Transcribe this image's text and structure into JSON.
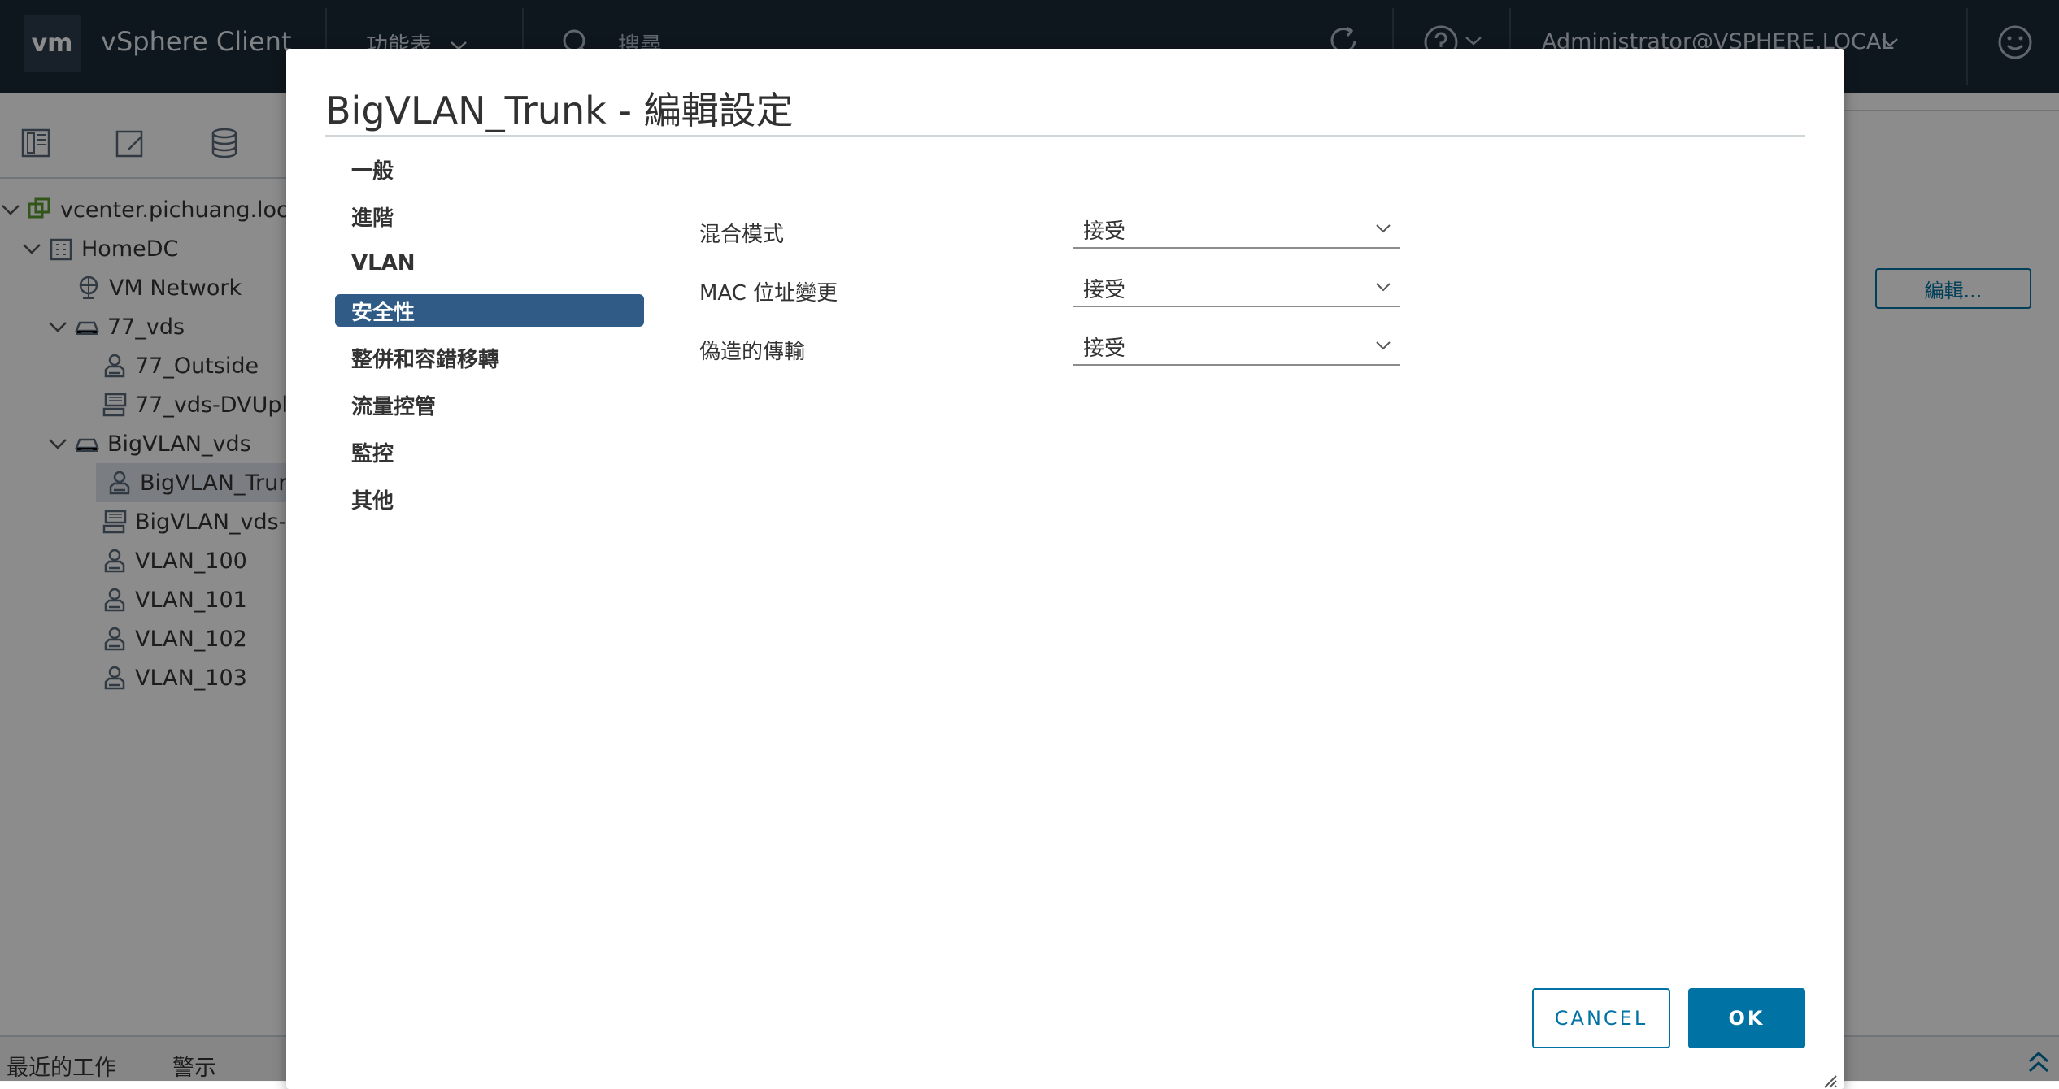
{
  "header": {
    "logo": "vm",
    "app_title": "vSphere Client",
    "menu_label": "功能表",
    "search_placeholder": "搜尋",
    "user": "Administrator@VSPHERE.LOCAL"
  },
  "tree": {
    "items": [
      {
        "label": "vcenter.pichuang.local",
        "icon": "vcenter-icon"
      },
      {
        "label": "HomeDC",
        "icon": "datacenter-icon"
      },
      {
        "label": "VM Network",
        "icon": "network-icon"
      },
      {
        "label": "77_vds",
        "icon": "vds-icon"
      },
      {
        "label": "77_Outside",
        "icon": "portgroup-icon"
      },
      {
        "label": "77_vds-DVUpl",
        "icon": "uplink-portgroup-icon"
      },
      {
        "label": "BigVLAN_vds",
        "icon": "vds-icon"
      },
      {
        "label": "BigVLAN_Trur",
        "icon": "portgroup-icon",
        "selected": true
      },
      {
        "label": "BigVLAN_vds-",
        "icon": "uplink-portgroup-icon"
      },
      {
        "label": "VLAN_100",
        "icon": "portgroup-icon"
      },
      {
        "label": "VLAN_101",
        "icon": "portgroup-icon"
      },
      {
        "label": "VLAN_102",
        "icon": "portgroup-icon"
      },
      {
        "label": "VLAN_103",
        "icon": "portgroup-icon"
      }
    ]
  },
  "background": {
    "edit_button": "編輯..."
  },
  "bottom": {
    "recent_tasks": "最近的工作",
    "alarms": "警示"
  },
  "dialog": {
    "title": "BigVLAN_Trunk - 編輯設定",
    "nav": [
      {
        "label": "一般"
      },
      {
        "label": "進階"
      },
      {
        "label": "VLAN"
      },
      {
        "label": "安全性",
        "active": true
      },
      {
        "label": "整併和容錯移轉"
      },
      {
        "label": "流量控管"
      },
      {
        "label": "監控"
      },
      {
        "label": "其他"
      }
    ],
    "fields": [
      {
        "label": "混合模式",
        "value": "接受"
      },
      {
        "label": "MAC 位址變更",
        "value": "接受"
      },
      {
        "label": "偽造的傳輸",
        "value": "接受"
      }
    ],
    "cancel_label": "CANCEL",
    "ok_label": "OK"
  },
  "colors": {
    "header_bg": "#1c2a38",
    "accent": "#0072a3",
    "nav_active": "#2f5b86"
  }
}
